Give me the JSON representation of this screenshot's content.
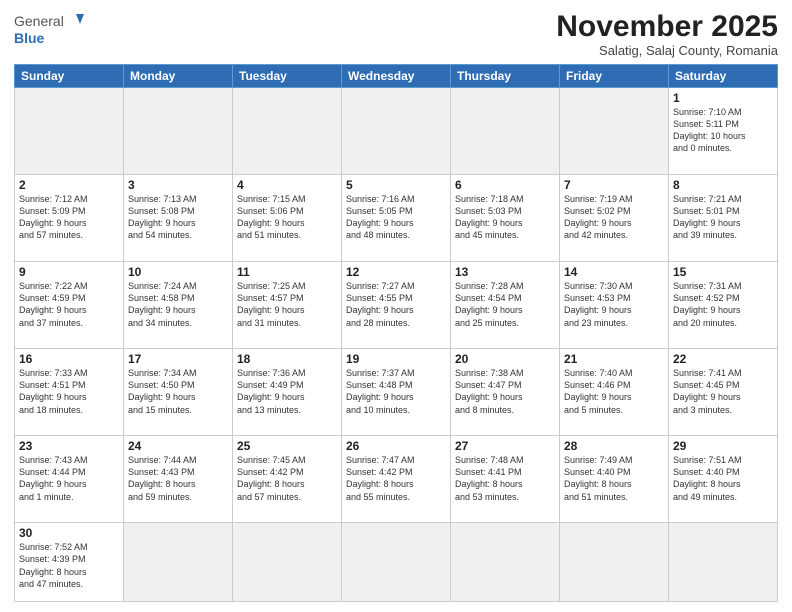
{
  "header": {
    "logo_general": "General",
    "logo_blue": "Blue",
    "month_title": "November 2025",
    "subtitle": "Salatig, Salaj County, Romania"
  },
  "weekdays": [
    "Sunday",
    "Monday",
    "Tuesday",
    "Wednesday",
    "Thursday",
    "Friday",
    "Saturday"
  ],
  "weeks": [
    [
      {
        "day": "",
        "info": ""
      },
      {
        "day": "",
        "info": ""
      },
      {
        "day": "",
        "info": ""
      },
      {
        "day": "",
        "info": ""
      },
      {
        "day": "",
        "info": ""
      },
      {
        "day": "",
        "info": ""
      },
      {
        "day": "1",
        "info": "Sunrise: 7:10 AM\nSunset: 5:11 PM\nDaylight: 10 hours\nand 0 minutes."
      }
    ],
    [
      {
        "day": "2",
        "info": "Sunrise: 7:12 AM\nSunset: 5:09 PM\nDaylight: 9 hours\nand 57 minutes."
      },
      {
        "day": "3",
        "info": "Sunrise: 7:13 AM\nSunset: 5:08 PM\nDaylight: 9 hours\nand 54 minutes."
      },
      {
        "day": "4",
        "info": "Sunrise: 7:15 AM\nSunset: 5:06 PM\nDaylight: 9 hours\nand 51 minutes."
      },
      {
        "day": "5",
        "info": "Sunrise: 7:16 AM\nSunset: 5:05 PM\nDaylight: 9 hours\nand 48 minutes."
      },
      {
        "day": "6",
        "info": "Sunrise: 7:18 AM\nSunset: 5:03 PM\nDaylight: 9 hours\nand 45 minutes."
      },
      {
        "day": "7",
        "info": "Sunrise: 7:19 AM\nSunset: 5:02 PM\nDaylight: 9 hours\nand 42 minutes."
      },
      {
        "day": "8",
        "info": "Sunrise: 7:21 AM\nSunset: 5:01 PM\nDaylight: 9 hours\nand 39 minutes."
      }
    ],
    [
      {
        "day": "9",
        "info": "Sunrise: 7:22 AM\nSunset: 4:59 PM\nDaylight: 9 hours\nand 37 minutes."
      },
      {
        "day": "10",
        "info": "Sunrise: 7:24 AM\nSunset: 4:58 PM\nDaylight: 9 hours\nand 34 minutes."
      },
      {
        "day": "11",
        "info": "Sunrise: 7:25 AM\nSunset: 4:57 PM\nDaylight: 9 hours\nand 31 minutes."
      },
      {
        "day": "12",
        "info": "Sunrise: 7:27 AM\nSunset: 4:55 PM\nDaylight: 9 hours\nand 28 minutes."
      },
      {
        "day": "13",
        "info": "Sunrise: 7:28 AM\nSunset: 4:54 PM\nDaylight: 9 hours\nand 25 minutes."
      },
      {
        "day": "14",
        "info": "Sunrise: 7:30 AM\nSunset: 4:53 PM\nDaylight: 9 hours\nand 23 minutes."
      },
      {
        "day": "15",
        "info": "Sunrise: 7:31 AM\nSunset: 4:52 PM\nDaylight: 9 hours\nand 20 minutes."
      }
    ],
    [
      {
        "day": "16",
        "info": "Sunrise: 7:33 AM\nSunset: 4:51 PM\nDaylight: 9 hours\nand 18 minutes."
      },
      {
        "day": "17",
        "info": "Sunrise: 7:34 AM\nSunset: 4:50 PM\nDaylight: 9 hours\nand 15 minutes."
      },
      {
        "day": "18",
        "info": "Sunrise: 7:36 AM\nSunset: 4:49 PM\nDaylight: 9 hours\nand 13 minutes."
      },
      {
        "day": "19",
        "info": "Sunrise: 7:37 AM\nSunset: 4:48 PM\nDaylight: 9 hours\nand 10 minutes."
      },
      {
        "day": "20",
        "info": "Sunrise: 7:38 AM\nSunset: 4:47 PM\nDaylight: 9 hours\nand 8 minutes."
      },
      {
        "day": "21",
        "info": "Sunrise: 7:40 AM\nSunset: 4:46 PM\nDaylight: 9 hours\nand 5 minutes."
      },
      {
        "day": "22",
        "info": "Sunrise: 7:41 AM\nSunset: 4:45 PM\nDaylight: 9 hours\nand 3 minutes."
      }
    ],
    [
      {
        "day": "23",
        "info": "Sunrise: 7:43 AM\nSunset: 4:44 PM\nDaylight: 9 hours\nand 1 minute."
      },
      {
        "day": "24",
        "info": "Sunrise: 7:44 AM\nSunset: 4:43 PM\nDaylight: 8 hours\nand 59 minutes."
      },
      {
        "day": "25",
        "info": "Sunrise: 7:45 AM\nSunset: 4:42 PM\nDaylight: 8 hours\nand 57 minutes."
      },
      {
        "day": "26",
        "info": "Sunrise: 7:47 AM\nSunset: 4:42 PM\nDaylight: 8 hours\nand 55 minutes."
      },
      {
        "day": "27",
        "info": "Sunrise: 7:48 AM\nSunset: 4:41 PM\nDaylight: 8 hours\nand 53 minutes."
      },
      {
        "day": "28",
        "info": "Sunrise: 7:49 AM\nSunset: 4:40 PM\nDaylight: 8 hours\nand 51 minutes."
      },
      {
        "day": "29",
        "info": "Sunrise: 7:51 AM\nSunset: 4:40 PM\nDaylight: 8 hours\nand 49 minutes."
      }
    ],
    [
      {
        "day": "30",
        "info": "Sunrise: 7:52 AM\nSunset: 4:39 PM\nDaylight: 8 hours\nand 47 minutes."
      },
      {
        "day": "",
        "info": ""
      },
      {
        "day": "",
        "info": ""
      },
      {
        "day": "",
        "info": ""
      },
      {
        "day": "",
        "info": ""
      },
      {
        "day": "",
        "info": ""
      },
      {
        "day": "",
        "info": ""
      }
    ]
  ]
}
